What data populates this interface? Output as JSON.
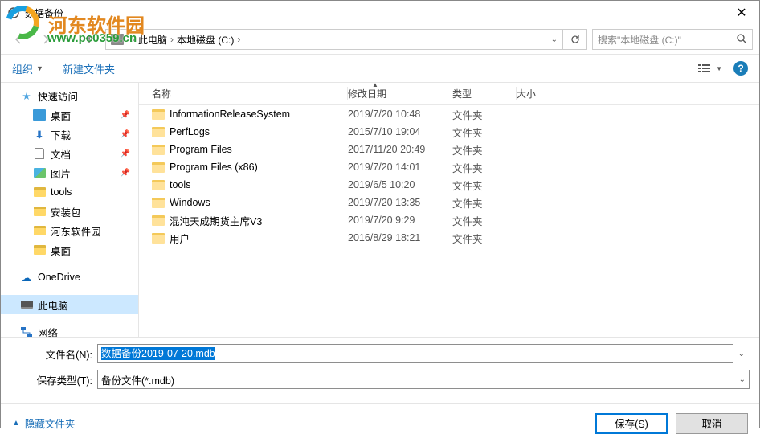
{
  "window": {
    "title": "数据备份",
    "close": "✕"
  },
  "watermark": {
    "brand": "河东软件园",
    "url": "www.pc0359.cn"
  },
  "addressbar": {
    "crumbs": [
      "此电脑",
      "本地磁盘 (C:)"
    ],
    "search_placeholder": "搜索\"本地磁盘 (C:)\""
  },
  "toolbar": {
    "organize": "组织",
    "new_folder": "新建文件夹"
  },
  "sidebar": {
    "quick_access": "快速访问",
    "items": [
      {
        "label": "桌面",
        "pinned": true,
        "icon": "desktop"
      },
      {
        "label": "下载",
        "pinned": true,
        "icon": "download"
      },
      {
        "label": "文档",
        "pinned": true,
        "icon": "document"
      },
      {
        "label": "图片",
        "pinned": true,
        "icon": "picture"
      },
      {
        "label": "tools",
        "pinned": false,
        "icon": "folder"
      },
      {
        "label": "安装包",
        "pinned": false,
        "icon": "folder"
      },
      {
        "label": "河东软件园",
        "pinned": false,
        "icon": "folder"
      },
      {
        "label": "桌面",
        "pinned": false,
        "icon": "folder"
      }
    ],
    "onedrive": "OneDrive",
    "this_pc": "此电脑",
    "network": "网络"
  },
  "columns": {
    "name": "名称",
    "date": "修改日期",
    "type": "类型",
    "size": "大小"
  },
  "files": [
    {
      "name": "InformationReleaseSystem",
      "date": "2019/7/20 10:48",
      "type": "文件夹"
    },
    {
      "name": "PerfLogs",
      "date": "2015/7/10 19:04",
      "type": "文件夹"
    },
    {
      "name": "Program Files",
      "date": "2017/11/20 20:49",
      "type": "文件夹"
    },
    {
      "name": "Program Files (x86)",
      "date": "2019/7/20 14:01",
      "type": "文件夹"
    },
    {
      "name": "tools",
      "date": "2019/6/5 10:20",
      "type": "文件夹"
    },
    {
      "name": "Windows",
      "date": "2019/7/20 13:35",
      "type": "文件夹"
    },
    {
      "name": "混沌天成期货主席V3",
      "date": "2019/7/20 9:29",
      "type": "文件夹"
    },
    {
      "name": "用户",
      "date": "2016/8/29 18:21",
      "type": "文件夹"
    }
  ],
  "form": {
    "filename_label": "文件名(N):",
    "filename_value": "数据备份2019-07-20.mdb",
    "filetype_label": "保存类型(T):",
    "filetype_value": "备份文件(*.mdb)"
  },
  "actions": {
    "hide_folders": "隐藏文件夹",
    "save": "保存(S)",
    "cancel": "取消"
  }
}
